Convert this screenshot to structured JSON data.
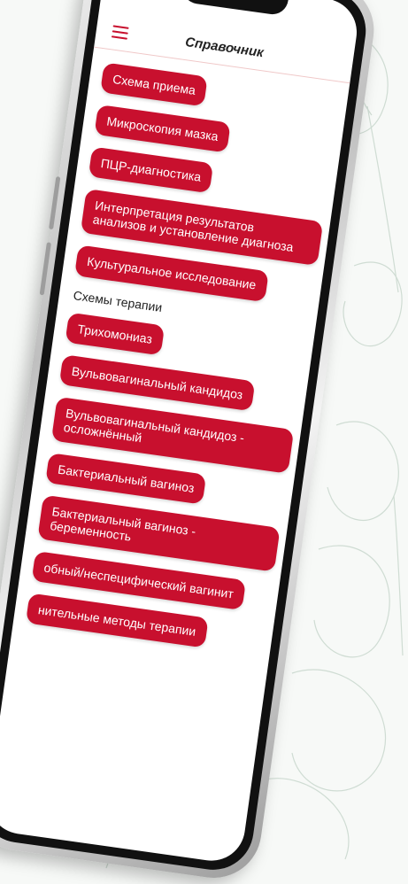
{
  "app": {
    "title": "Справочник"
  },
  "icons": {
    "menu": "hamburger-menu-icon"
  },
  "colors": {
    "accent": "#c8102e",
    "background": "#f7f9f7",
    "screen": "#ffffff"
  },
  "menu": {
    "items": [
      "Схема приема",
      "Микроскопия мазка",
      "ПЦР-диагностика",
      "Интерпретация результатов анализов и установление диагноза",
      "Культуральное исследование"
    ]
  },
  "therapy": {
    "section_label": "Схемы терапии",
    "items": [
      "Трихомониаз",
      "Вульвовагинальный кандидоз",
      "Вульвовагинальный кандидоз - осложнённый",
      "Бактериальный вагиноз",
      "Бактериальный вагиноз - беременность",
      "обный/неспецифический вагинит",
      "нительные методы терапии"
    ]
  }
}
